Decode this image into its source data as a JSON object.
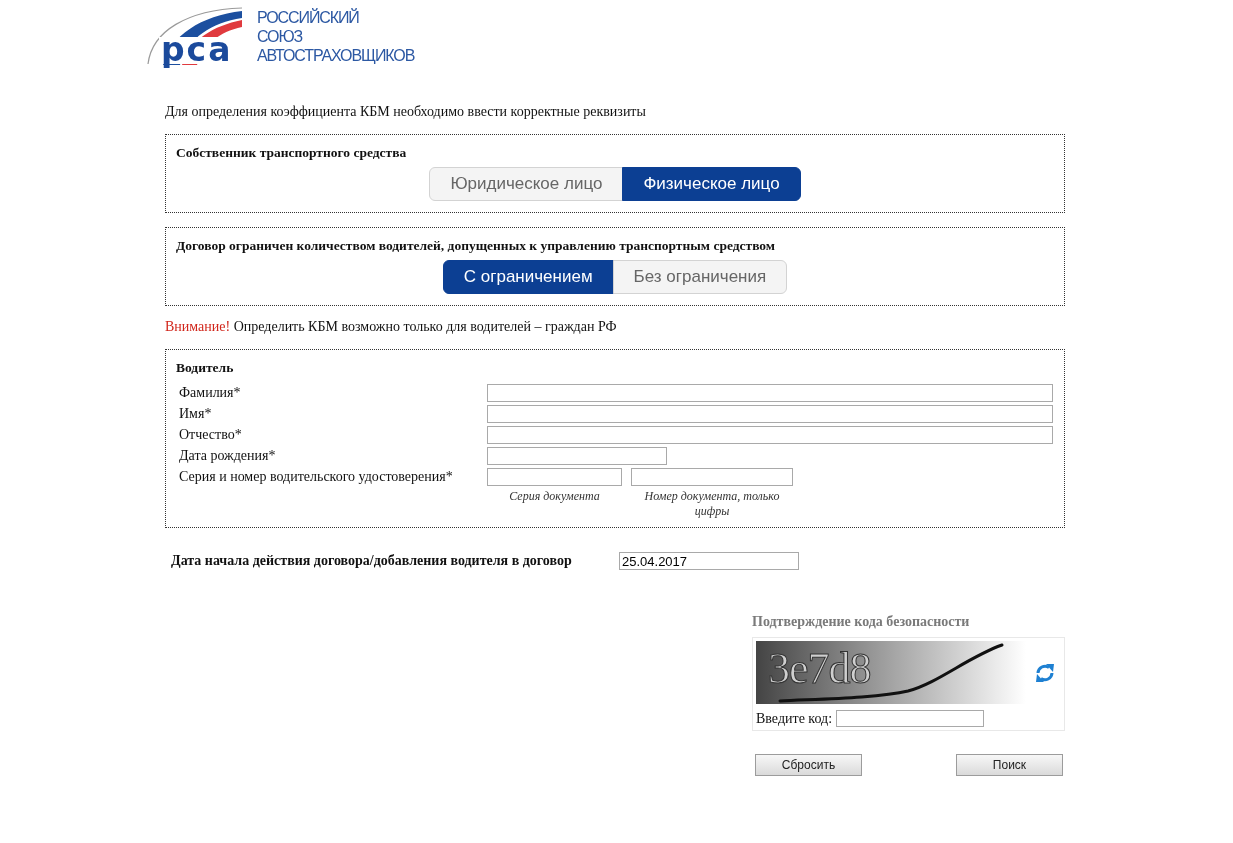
{
  "logo": {
    "abbreviation": "рса",
    "lines": [
      "РОССИЙСКИЙ",
      "СОЮЗ",
      "АВТОСТРАХОВЩИКОВ"
    ]
  },
  "intro": "Для определения коэффициента КБМ необходимо ввести корректные реквизиты",
  "owner": {
    "title": "Собственник транспортного средства",
    "options": [
      {
        "label": "Юридическое лицо",
        "selected": false
      },
      {
        "label": "Физическое лицо",
        "selected": true
      }
    ]
  },
  "drivers_limit": {
    "title": "Договор ограничен количеством водителей, допущенных к управлению транспортным средством",
    "options": [
      {
        "label": "С ограничением",
        "selected": true
      },
      {
        "label": "Без ограничения",
        "selected": false
      }
    ]
  },
  "warning": {
    "label": "Внимание!",
    "text": "Определить КБМ возможно только для водителей – граждан РФ"
  },
  "driver": {
    "title": "Водитель",
    "fields": [
      {
        "kind": "text",
        "label": "Фамилия*"
      },
      {
        "kind": "text",
        "label": "Имя*"
      },
      {
        "kind": "text",
        "label": "Отчество*"
      },
      {
        "kind": "date",
        "label": "Дата рождения*"
      },
      {
        "kind": "document",
        "label": "Серия и номер водительского удостоверения*",
        "hints": [
          "Серия документа",
          "Номер документа, только цифры"
        ]
      }
    ]
  },
  "contract_date": {
    "label": "Дата начала действия договора/добавления водителя в договор",
    "value": "25.04.2017"
  },
  "captcha": {
    "title": "Подтверждение кода безопасности",
    "code": "3e7d8",
    "input_label": "Введите код:"
  },
  "buttons": [
    {
      "label": "Сбросить"
    },
    {
      "label": "Поиск"
    }
  ]
}
